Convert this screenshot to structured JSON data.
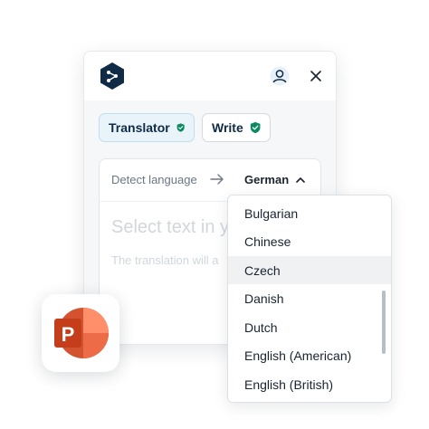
{
  "header": {
    "logo_icon": "deepl-logo-icon",
    "avatar_icon": "user-avatar-icon",
    "close_icon": "close-icon"
  },
  "tabs": [
    {
      "label": "Translator",
      "icon": "shield-check-icon",
      "active": true
    },
    {
      "label": "Write",
      "icon": "shield-check-icon",
      "active": false
    }
  ],
  "language_bar": {
    "source": "Detect language",
    "target": "German"
  },
  "editor": {
    "placeholder": "Select text in y",
    "hint": "The translation will a"
  },
  "dropdown": {
    "options": [
      "Bulgarian",
      "Chinese",
      "Czech",
      "Danish",
      "Dutch",
      "English (American)",
      "English (British)"
    ],
    "highlighted": "Czech"
  },
  "app_badge": {
    "icon": "powerpoint-icon",
    "letter": "P"
  },
  "colors": {
    "brand_navy": "#0f2b46",
    "shield_green": "#0b8a5f",
    "ppt_orange": "#d35230",
    "ppt_red": "#c43e1c"
  }
}
